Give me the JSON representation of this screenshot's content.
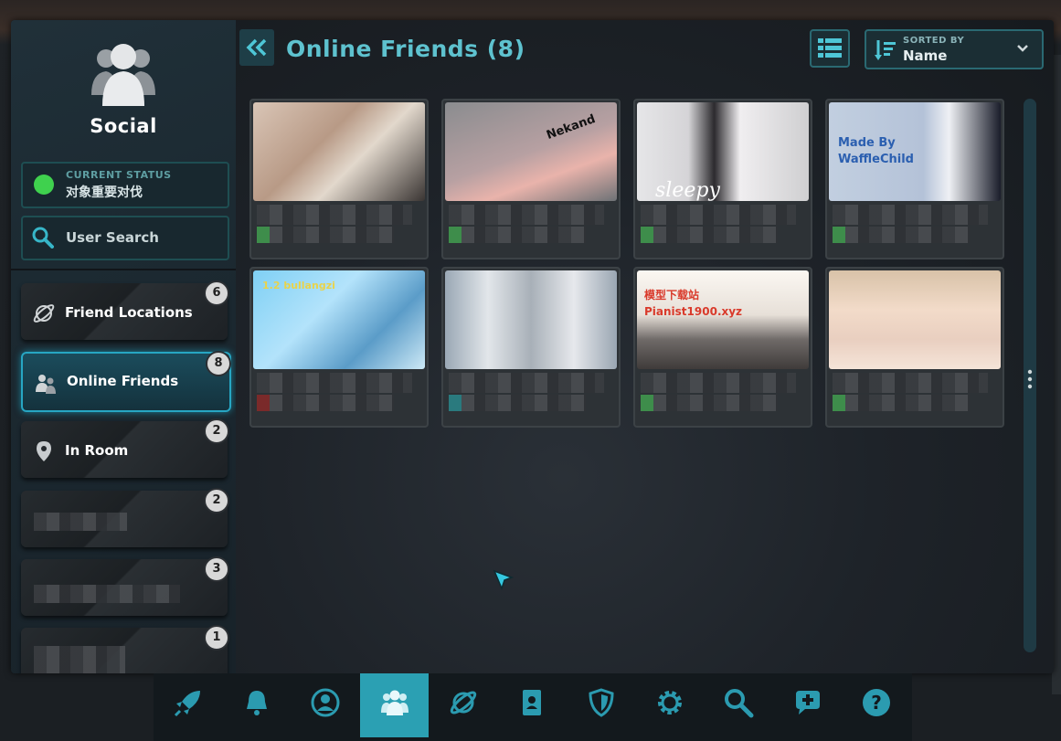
{
  "sidebar": {
    "title": "Social",
    "status": {
      "label": "CURRENT STATUS",
      "value": "对象重要对伐",
      "color": "#3fd14e"
    },
    "search": {
      "label": "User Search"
    },
    "items": [
      {
        "label": "Friend Locations",
        "count": "6",
        "icon": "planet-icon"
      },
      {
        "label": "Online Friends",
        "count": "8",
        "icon": "friends-icon",
        "active": true
      },
      {
        "label": "In Room",
        "count": "2",
        "icon": "location-pin-icon"
      },
      {
        "label": "",
        "count": "2",
        "icon": ""
      },
      {
        "label": "",
        "count": "3",
        "icon": ""
      },
      {
        "label": "",
        "count": "1",
        "icon": ""
      }
    ]
  },
  "main": {
    "title": "Online Friends (8)",
    "sort": {
      "label": "SORTED BY",
      "value": "Name"
    },
    "friends": [
      {
        "thumb_text": "",
        "status_color": "#3e8d4b"
      },
      {
        "thumb_text": "Nekand",
        "status_color": "#3e8d4b"
      },
      {
        "thumb_text": "sleepy",
        "status_color": "#3e8d4b"
      },
      {
        "thumb_text": "Made By WaffleChild",
        "status_color": "#3e8d4b"
      },
      {
        "thumb_text": "1.2 bullangzi",
        "status_color": "#7a2a2a"
      },
      {
        "thumb_text": "",
        "status_color": "#2a7a7e"
      },
      {
        "thumb_text": "模型下载站 Pianist1900.xyz",
        "status_color": "#3e8d4b"
      },
      {
        "thumb_text": "",
        "status_color": "#3e8d4b"
      }
    ]
  },
  "dock": {
    "items": [
      "rocket-icon",
      "bell-icon",
      "profile-icon",
      "social-icon",
      "planet-icon",
      "passport-icon",
      "shield-icon",
      "settings-icon",
      "search-icon",
      "chat-add-icon",
      "help-icon"
    ],
    "active": "social-icon"
  },
  "colors": {
    "accent": "#2ba0b3",
    "title": "#5ec2cf"
  }
}
